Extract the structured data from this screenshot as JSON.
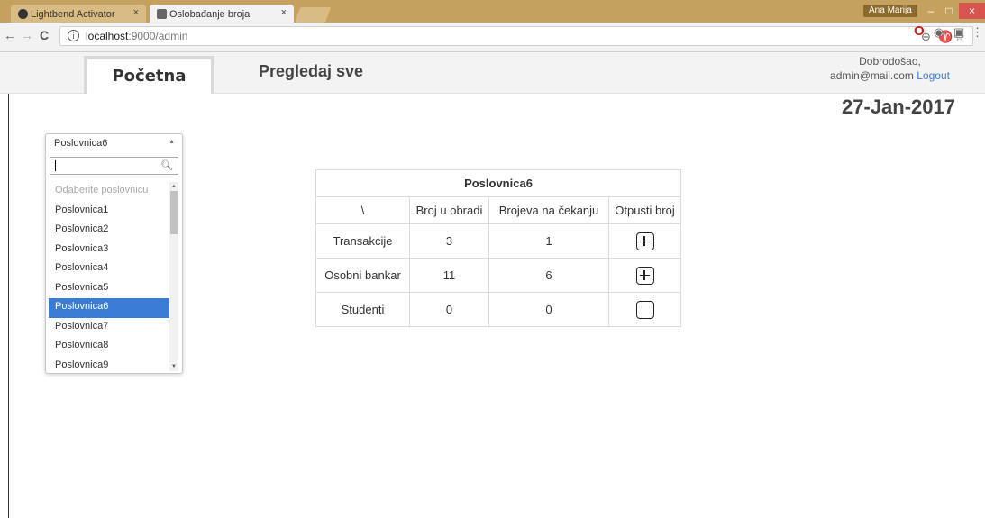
{
  "browser": {
    "tabs": [
      {
        "title": "Lightbend Activator",
        "close": "×"
      },
      {
        "title": "Oslobađanje broja",
        "close": "×"
      }
    ],
    "user_chip": "Ana Marija",
    "url_host": "localhost",
    "url_rest": ":9000/admin",
    "window_controls": {
      "min": "–",
      "max": "□",
      "close": "×"
    },
    "nav": {
      "back": "←",
      "forward": "→",
      "reload": "C"
    },
    "icons": [
      "zoom-icon",
      "extension-icon",
      "bookmark-star-icon",
      "opera-icon",
      "extension-icon",
      "extension-icon",
      "menu-icon"
    ]
  },
  "header": {
    "home_label": "Početna",
    "view_all_label": "Pregledaj sve",
    "welcome_text": "Dobrodošao,",
    "user_email": "admin@mail.com",
    "logout_label": "Logout"
  },
  "date": "27-Jan-2017",
  "dropdown": {
    "selected": "Poslovnica6",
    "search_value": "",
    "placeholder": "Odaberite poslovnicu",
    "options": [
      "Poslovnica1",
      "Poslovnica2",
      "Poslovnica3",
      "Poslovnica4",
      "Poslovnica5",
      "Poslovnica6",
      "Poslovnica7",
      "Poslovnica8",
      "Poslovnica9"
    ]
  },
  "table": {
    "title": "Poslovnica6",
    "columns": [
      "\\",
      "Broj u obradi",
      "Brojeva na čekanju",
      "Otpusti broj"
    ],
    "rows": [
      {
        "name": "Transakcije",
        "processing": "3",
        "waiting": "1"
      },
      {
        "name": "Osobni bankar",
        "processing": "11",
        "waiting": "6"
      },
      {
        "name": "Studenti",
        "processing": "0",
        "waiting": "0"
      }
    ]
  },
  "colors": {
    "tabstrip": "#c4a15e",
    "accent": "#3a7bd5",
    "close_button": "#d9534f"
  }
}
